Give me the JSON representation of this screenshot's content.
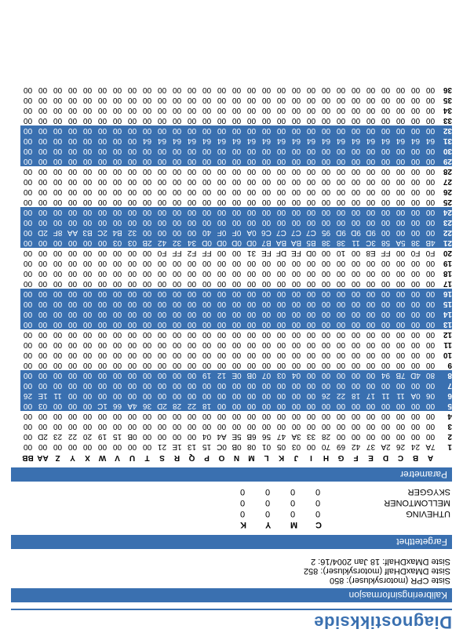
{
  "title": "Diagnostikkside",
  "sections": {
    "calib": "Kalibreringsinformasjon",
    "sat": "Fargetetthet",
    "param": "Parametrer"
  },
  "calib_lines": [
    "Siste CPR (motorsykluser): 850",
    "Siste DMaxDHalf (motorsykluser): 852",
    "Siste DMaxDHalf: 18 Jan 2004/16: 2"
  ],
  "sat_table": {
    "cols": [
      "",
      "C",
      "M",
      "Y",
      "K"
    ],
    "rows": [
      {
        "label": "UTHEVING",
        "v": [
          "0",
          "0",
          "0",
          "0"
        ]
      },
      {
        "label": "MELLOMTONER",
        "v": [
          "0",
          "0",
          "0",
          "0"
        ]
      },
      {
        "label": "SKYGGER",
        "v": [
          "0",
          "0",
          "0",
          "0"
        ]
      }
    ]
  },
  "hex": {
    "cols": [
      "A",
      "B",
      "C",
      "D",
      "E",
      "F",
      "G",
      "H",
      "I",
      "J",
      "K",
      "L",
      "M",
      "N",
      "O",
      "P",
      "Q",
      "R",
      "S",
      "T",
      "U",
      "V",
      "W",
      "X",
      "Y",
      "Z",
      "AA",
      "BB"
    ],
    "highlight": [
      5,
      6,
      7,
      8,
      13,
      14,
      15,
      16,
      21,
      22,
      23,
      24,
      29,
      30,
      31,
      32
    ],
    "rows": [
      {
        "n": 1,
        "c": [
          "7A",
          "24",
          "26",
          "2A",
          "37",
          "42",
          "69",
          "70",
          "00",
          "03",
          "05",
          "01",
          "08",
          "0B",
          "0C",
          "15",
          "13",
          "1E",
          "21",
          "00",
          "00",
          "00",
          "00",
          "00",
          "00",
          "00",
          "00",
          "00"
        ]
      },
      {
        "n": 2,
        "c": [
          "00",
          "00",
          "00",
          "00",
          "00",
          "00",
          "00",
          "28",
          "33",
          "3A",
          "47",
          "56",
          "6B",
          "5E",
          "A4",
          "04",
          "00",
          "00",
          "00",
          "00",
          "0B",
          "15",
          "19",
          "20",
          "22",
          "23",
          "2D",
          "00"
        ]
      },
      {
        "n": 3,
        "c": [
          "00",
          "00",
          "00",
          "00",
          "00",
          "00",
          "00",
          "00",
          "00",
          "00",
          "00",
          "00",
          "00",
          "00",
          "00",
          "00",
          "00",
          "00",
          "00",
          "00",
          "00",
          "00",
          "00",
          "00",
          "00",
          "00",
          "00",
          "00"
        ]
      },
      {
        "n": 4,
        "c": [
          "00",
          "00",
          "00",
          "00",
          "00",
          "00",
          "00",
          "00",
          "00",
          "00",
          "00",
          "00",
          "00",
          "00",
          "00",
          "00",
          "00",
          "00",
          "00",
          "00",
          "00",
          "00",
          "00",
          "00",
          "00",
          "00",
          "00",
          "00"
        ]
      },
      {
        "n": 5,
        "c": [
          "00",
          "00",
          "00",
          "00",
          "00",
          "00",
          "00",
          "00",
          "00",
          "00",
          "00",
          "00",
          "00",
          "00",
          "00",
          "18",
          "22",
          "28",
          "2D",
          "36",
          "4A",
          "66",
          "1C",
          "00",
          "00",
          "00",
          "03",
          "00"
        ]
      },
      {
        "n": 6,
        "c": [
          "06",
          "0A",
          "11",
          "11",
          "17",
          "18",
          "22",
          "26",
          "00",
          "00",
          "00",
          "00",
          "00",
          "00",
          "00",
          "00",
          "00",
          "00",
          "00",
          "00",
          "00",
          "00",
          "00",
          "00",
          "00",
          "11",
          "1E",
          "26"
        ]
      },
      {
        "n": 7,
        "c": [
          "00",
          "00",
          "00",
          "00",
          "00",
          "00",
          "00",
          "00",
          "00",
          "00",
          "00",
          "00",
          "00",
          "00",
          "00",
          "00",
          "00",
          "00",
          "00",
          "00",
          "00",
          "00",
          "00",
          "00",
          "00",
          "00",
          "00",
          "00"
        ]
      },
      {
        "n": 8,
        "c": [
          "80",
          "4D",
          "7B",
          "94",
          "00",
          "00",
          "00",
          "00",
          "00",
          "04",
          "03",
          "07",
          "0B",
          "0E",
          "12",
          "19",
          "00",
          "00",
          "00",
          "00",
          "00",
          "00",
          "00",
          "00",
          "00",
          "00",
          "00",
          "00"
        ]
      },
      {
        "n": 9,
        "c": [
          "00",
          "00",
          "00",
          "00",
          "00",
          "00",
          "00",
          "00",
          "00",
          "00",
          "00",
          "00",
          "00",
          "00",
          "00",
          "00",
          "00",
          "00",
          "00",
          "00",
          "00",
          "00",
          "00",
          "00",
          "00",
          "00",
          "00",
          "00"
        ]
      },
      {
        "n": 10,
        "c": [
          "00",
          "00",
          "00",
          "00",
          "00",
          "00",
          "00",
          "00",
          "00",
          "00",
          "00",
          "00",
          "00",
          "00",
          "00",
          "00",
          "00",
          "00",
          "00",
          "00",
          "00",
          "00",
          "00",
          "00",
          "00",
          "00",
          "00",
          "00"
        ]
      },
      {
        "n": 11,
        "c": [
          "00",
          "00",
          "00",
          "00",
          "00",
          "00",
          "00",
          "00",
          "00",
          "00",
          "00",
          "00",
          "00",
          "00",
          "00",
          "00",
          "00",
          "00",
          "00",
          "00",
          "00",
          "00",
          "00",
          "00",
          "00",
          "00",
          "00",
          "00"
        ]
      },
      {
        "n": 12,
        "c": [
          "00",
          "00",
          "00",
          "00",
          "00",
          "00",
          "00",
          "00",
          "00",
          "00",
          "00",
          "00",
          "00",
          "00",
          "00",
          "00",
          "00",
          "00",
          "00",
          "00",
          "00",
          "00",
          "00",
          "00",
          "00",
          "00",
          "00",
          "00"
        ]
      },
      {
        "n": 13,
        "c": [
          "00",
          "00",
          "00",
          "00",
          "00",
          "00",
          "00",
          "00",
          "00",
          "00",
          "00",
          "00",
          "00",
          "00",
          "00",
          "00",
          "00",
          "00",
          "00",
          "00",
          "00",
          "00",
          "00",
          "00",
          "00",
          "00",
          "00",
          "00"
        ]
      },
      {
        "n": 14,
        "c": [
          "00",
          "00",
          "00",
          "00",
          "00",
          "00",
          "00",
          "00",
          "00",
          "00",
          "00",
          "00",
          "00",
          "00",
          "00",
          "00",
          "00",
          "00",
          "00",
          "00",
          "00",
          "00",
          "00",
          "00",
          "00",
          "00",
          "00",
          "00"
        ]
      },
      {
        "n": 15,
        "c": [
          "00",
          "00",
          "00",
          "00",
          "00",
          "00",
          "00",
          "00",
          "00",
          "00",
          "00",
          "00",
          "00",
          "00",
          "00",
          "00",
          "00",
          "00",
          "00",
          "00",
          "00",
          "00",
          "00",
          "00",
          "00",
          "00",
          "00",
          "00"
        ]
      },
      {
        "n": 16,
        "c": [
          "00",
          "00",
          "00",
          "00",
          "00",
          "00",
          "00",
          "00",
          "00",
          "00",
          "00",
          "00",
          "00",
          "00",
          "00",
          "00",
          "00",
          "00",
          "00",
          "00",
          "00",
          "00",
          "00",
          "00",
          "00",
          "00",
          "00",
          "00"
        ]
      },
      {
        "n": 17,
        "c": [
          "00",
          "00",
          "00",
          "00",
          "00",
          "00",
          "00",
          "00",
          "00",
          "00",
          "00",
          "00",
          "00",
          "00",
          "00",
          "00",
          "00",
          "00",
          "00",
          "00",
          "00",
          "00",
          "00",
          "00",
          "00",
          "00",
          "00",
          "00"
        ]
      },
      {
        "n": 18,
        "c": [
          "00",
          "00",
          "00",
          "00",
          "00",
          "00",
          "00",
          "00",
          "00",
          "00",
          "00",
          "00",
          "00",
          "00",
          "00",
          "00",
          "00",
          "00",
          "00",
          "00",
          "00",
          "00",
          "00",
          "00",
          "00",
          "00",
          "00",
          "00"
        ]
      },
      {
        "n": 19,
        "c": [
          "00",
          "00",
          "00",
          "00",
          "00",
          "00",
          "00",
          "00",
          "00",
          "00",
          "00",
          "00",
          "00",
          "00",
          "00",
          "00",
          "00",
          "00",
          "00",
          "00",
          "00",
          "00",
          "00",
          "00",
          "00",
          "00",
          "00",
          "00"
        ]
      },
      {
        "n": 20,
        "c": [
          "F0",
          "F0",
          "00",
          "FF",
          "E8",
          "00",
          "10",
          "00",
          "0D",
          "FE",
          "DF",
          "FE",
          "31",
          "00",
          "00",
          "FF",
          "F2",
          "FF",
          "F0",
          "00",
          "00",
          "00",
          "00",
          "00",
          "00",
          "00",
          "00",
          "00"
        ]
      },
      {
        "n": 21,
        "c": [
          "4B",
          "38",
          "5A",
          "58",
          "3C",
          "11",
          "38",
          "38",
          "B5",
          "BA",
          "BA",
          "B7",
          "0D",
          "0D",
          "0D",
          "0D",
          "34",
          "32",
          "42",
          "2B",
          "03",
          "03",
          "00",
          "00",
          "00",
          "00",
          "00",
          "00"
        ]
      },
      {
        "n": 22,
        "c": [
          "00",
          "00",
          "00",
          "00",
          "9D",
          "9D",
          "9D",
          "95",
          "C7",
          "C7",
          "C7",
          "C6",
          "0A",
          "0F",
          "0F",
          "40",
          "00",
          "00",
          "00",
          "00",
          "32",
          "B4",
          "2C",
          "B3",
          "AA",
          "8F",
          "2D",
          "00"
        ]
      },
      {
        "n": 23,
        "c": [
          "00",
          "00",
          "00",
          "00",
          "00",
          "00",
          "00",
          "00",
          "00",
          "00",
          "00",
          "00",
          "00",
          "00",
          "00",
          "00",
          "00",
          "00",
          "00",
          "00",
          "00",
          "00",
          "00",
          "00",
          "00",
          "00",
          "00",
          "00"
        ]
      },
      {
        "n": 24,
        "c": [
          "00",
          "00",
          "00",
          "00",
          "00",
          "00",
          "00",
          "00",
          "00",
          "00",
          "00",
          "00",
          "00",
          "00",
          "00",
          "00",
          "00",
          "00",
          "00",
          "00",
          "00",
          "00",
          "00",
          "00",
          "00",
          "00",
          "00",
          "00"
        ]
      },
      {
        "n": 25,
        "c": [
          "00",
          "00",
          "00",
          "00",
          "00",
          "00",
          "00",
          "00",
          "00",
          "00",
          "00",
          "00",
          "00",
          "00",
          "00",
          "00",
          "00",
          "00",
          "00",
          "00",
          "00",
          "00",
          "00",
          "00",
          "00",
          "00",
          "00",
          "00"
        ]
      },
      {
        "n": 26,
        "c": [
          "00",
          "00",
          "00",
          "00",
          "00",
          "00",
          "00",
          "00",
          "00",
          "00",
          "00",
          "00",
          "00",
          "00",
          "00",
          "00",
          "00",
          "00",
          "00",
          "00",
          "00",
          "00",
          "00",
          "00",
          "00",
          "00",
          "00",
          "00"
        ]
      },
      {
        "n": 27,
        "c": [
          "00",
          "00",
          "00",
          "00",
          "00",
          "00",
          "00",
          "00",
          "00",
          "00",
          "00",
          "00",
          "00",
          "00",
          "00",
          "00",
          "00",
          "00",
          "00",
          "00",
          "00",
          "00",
          "00",
          "00",
          "00",
          "00",
          "00",
          "00"
        ]
      },
      {
        "n": 28,
        "c": [
          "00",
          "00",
          "00",
          "00",
          "00",
          "00",
          "00",
          "00",
          "00",
          "00",
          "00",
          "00",
          "00",
          "00",
          "00",
          "00",
          "00",
          "00",
          "00",
          "00",
          "00",
          "00",
          "00",
          "00",
          "00",
          "00",
          "00",
          "00"
        ]
      },
      {
        "n": 29,
        "c": [
          "00",
          "00",
          "00",
          "00",
          "00",
          "00",
          "00",
          "00",
          "00",
          "00",
          "00",
          "00",
          "00",
          "00",
          "00",
          "00",
          "00",
          "00",
          "00",
          "00",
          "00",
          "00",
          "00",
          "00",
          "00",
          "00",
          "00",
          "00"
        ]
      },
      {
        "n": 30,
        "c": [
          "00",
          "00",
          "00",
          "00",
          "00",
          "00",
          "00",
          "00",
          "00",
          "00",
          "00",
          "00",
          "00",
          "00",
          "00",
          "00",
          "00",
          "00",
          "00",
          "00",
          "00",
          "00",
          "00",
          "00",
          "00",
          "00",
          "00",
          "00"
        ]
      },
      {
        "n": 31,
        "c": [
          "64",
          "64",
          "64",
          "64",
          "64",
          "64",
          "64",
          "64",
          "64",
          "64",
          "64",
          "64",
          "64",
          "64",
          "64",
          "64",
          "64",
          "64",
          "64",
          "64",
          "00",
          "00",
          "00",
          "00",
          "00",
          "00",
          "00",
          "00"
        ]
      },
      {
        "n": 32,
        "c": [
          "00",
          "00",
          "00",
          "00",
          "00",
          "00",
          "00",
          "00",
          "00",
          "00",
          "00",
          "00",
          "00",
          "00",
          "00",
          "00",
          "00",
          "00",
          "00",
          "00",
          "00",
          "00",
          "00",
          "00",
          "00",
          "00",
          "00",
          "00"
        ]
      },
      {
        "n": 33,
        "c": [
          "00",
          "00",
          "00",
          "00",
          "00",
          "00",
          "00",
          "00",
          "00",
          "00",
          "00",
          "00",
          "00",
          "00",
          "00",
          "00",
          "00",
          "00",
          "00",
          "00",
          "00",
          "00",
          "00",
          "00",
          "00",
          "00",
          "00",
          "00"
        ]
      },
      {
        "n": 34,
        "c": [
          "00",
          "00",
          "00",
          "00",
          "00",
          "00",
          "00",
          "00",
          "00",
          "00",
          "00",
          "00",
          "00",
          "00",
          "00",
          "00",
          "00",
          "00",
          "00",
          "00",
          "00",
          "00",
          "00",
          "00",
          "00",
          "00",
          "00",
          "00"
        ]
      },
      {
        "n": 35,
        "c": [
          "00",
          "00",
          "00",
          "00",
          "00",
          "00",
          "00",
          "00",
          "00",
          "00",
          "00",
          "00",
          "00",
          "00",
          "00",
          "00",
          "00",
          "00",
          "00",
          "00",
          "00",
          "00",
          "00",
          "00",
          "00",
          "00",
          "00",
          "00"
        ]
      },
      {
        "n": 36,
        "c": [
          "00",
          "00",
          "00",
          "00",
          "00",
          "00",
          "00",
          "00",
          "00",
          "00",
          "00",
          "00",
          "00",
          "00",
          "00",
          "00",
          "00",
          "00",
          "00",
          "00",
          "00",
          "00",
          "00",
          "00",
          "00",
          "00",
          "00",
          "00"
        ]
      }
    ]
  }
}
